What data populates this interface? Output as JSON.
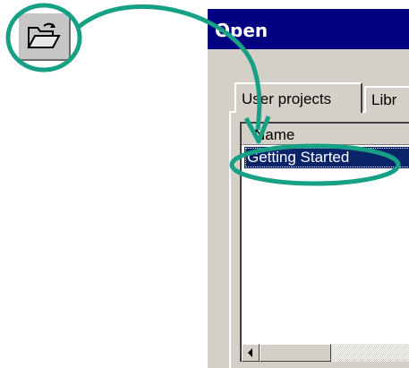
{
  "toolbar": {
    "open_button_icon": "open-folder-icon"
  },
  "dialog": {
    "title": "Open",
    "tabs": [
      {
        "label": "User projects",
        "selected": true
      },
      {
        "label": "Libr",
        "selected": false
      }
    ],
    "list": {
      "column_header": "Name",
      "items": [
        {
          "label": "Getting Started",
          "selected": true
        }
      ]
    },
    "scrollbar": {
      "left_arrow_icon": "scroll-left-arrow-icon"
    }
  },
  "annotation": {
    "highlight_color": "#16a085"
  },
  "colors": {
    "titlebar": "#000080",
    "selection": "#0a246a",
    "face": "#d4d0c8"
  }
}
